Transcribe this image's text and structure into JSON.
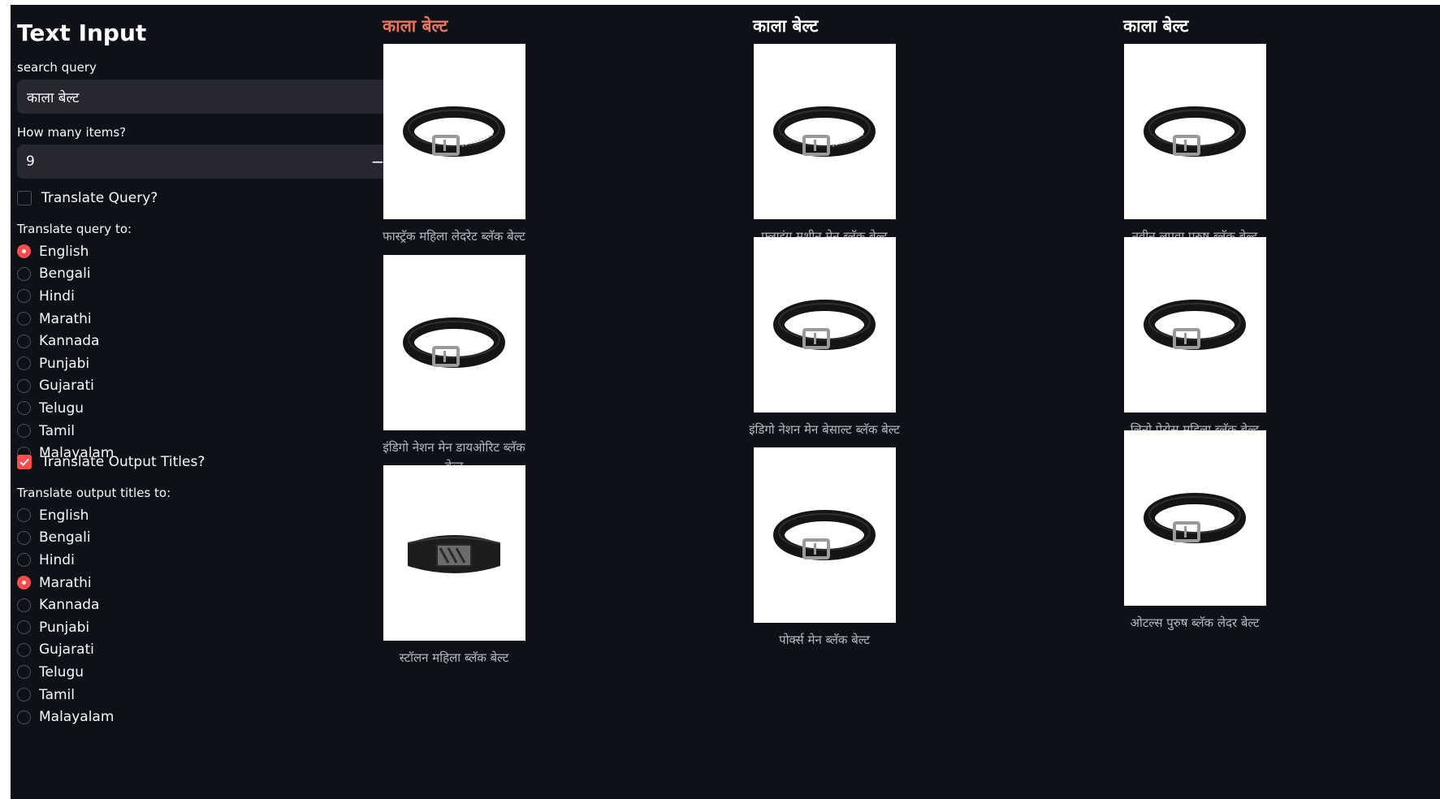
{
  "sidebar": {
    "title": "Text Input",
    "search_label": "search query",
    "search_value": "काला बेल्ट",
    "count_label": "How many items?",
    "count_value": "9",
    "minus": "−",
    "plus": "+",
    "translate_query_label": "Translate Query?",
    "translate_query_checked": false,
    "query_to_label": "Translate query to:",
    "query_languages": [
      "English",
      "Bengali",
      "Hindi",
      "Marathi",
      "Kannada",
      "Punjabi",
      "Gujarati",
      "Telugu",
      "Tamil",
      "Malayalam"
    ],
    "query_selected": "English",
    "translate_titles_label": "Translate Output Titles?",
    "translate_titles_checked": true,
    "titles_to_label": "Translate output titles to:",
    "title_languages": [
      "English",
      "Bengali",
      "Hindi",
      "Marathi",
      "Kannada",
      "Punjabi",
      "Gujarati",
      "Telugu",
      "Tamil",
      "Malayalam"
    ],
    "titles_selected": "Marathi"
  },
  "columns": [
    {
      "heading": "काला बेल्ट",
      "heading_color": "#e8735f",
      "items": [
        {
          "caption": "फास्ट्रॅक महिला लेदरेट ब्लॅक बेल्ट",
          "belt_icon": "perforated-belt-icon"
        },
        {
          "caption": "इंडिगो नेशन मेन डायओरिट ब्लॅक बेल्ट",
          "belt_icon": "belt-icon"
        },
        {
          "caption": "स्टॉलन महिला ब्लॅक बेल्ट",
          "belt_icon": "elastic-belt-icon"
        }
      ]
    },
    {
      "heading": "काला बेल्ट",
      "heading_color": "#ffffff",
      "items": [
        {
          "caption": "फ्लाइंग मशीन मेन ब्लॅक बेल्ट",
          "belt_icon": "perforated-belt-icon"
        },
        {
          "caption": "इंडिगो नेशन मेन बेसाल्ट ब्लॅक बेल्ट",
          "belt_icon": "belt-icon"
        },
        {
          "caption": "पोर्क्स मेन ब्लॅक बेल्ट",
          "belt_icon": "belt-icon"
        }
      ]
    },
    {
      "heading": "काला बेल्ट",
      "heading_color": "#ffffff",
      "items": [
        {
          "caption": "नवीन लपवा पुरुष ब्लॅक बेल्ट",
          "belt_icon": "belt-icon"
        },
        {
          "caption": "लिनो पेरोस महिला ब्लॅक बेल्ट",
          "belt_icon": "belt-icon"
        },
        {
          "caption": "ओटल्स पुरुष ब्लॅक लेदर बेल्ट",
          "belt_icon": "belt-icon"
        }
      ]
    }
  ],
  "colors": {
    "background": "#0e1117",
    "input": "#262730",
    "accent": "#ff4b4b"
  }
}
